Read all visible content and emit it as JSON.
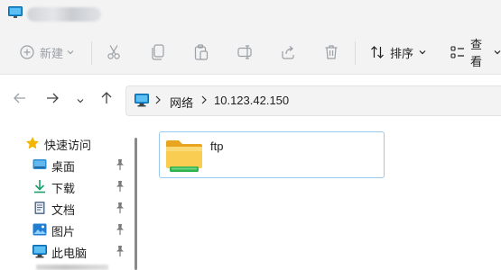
{
  "window": {
    "title_icon": "pc-icon"
  },
  "commandbar": {
    "new_label": "新建",
    "sort_label": "排序",
    "view_label": "查看",
    "icons": {
      "new": "plus-circle-icon",
      "cut": "scissors-icon",
      "copy": "copy-icon",
      "paste": "paste-icon",
      "rename": "rename-icon",
      "share": "share-icon",
      "delete": "trash-icon",
      "sort": "sort-icon",
      "view": "view-icon"
    }
  },
  "address": {
    "crumbs": [
      "网络",
      "10.123.42.150"
    ]
  },
  "sidebar": {
    "items": [
      {
        "label": "快速访问",
        "icon": "star-icon",
        "pinned": false
      },
      {
        "label": "桌面",
        "icon": "desktop-icon",
        "pinned": true
      },
      {
        "label": "下载",
        "icon": "download-icon",
        "pinned": true
      },
      {
        "label": "文档",
        "icon": "document-icon",
        "pinned": true
      },
      {
        "label": "图片",
        "icon": "picture-icon",
        "pinned": true
      },
      {
        "label": "此电脑",
        "icon": "pc-icon",
        "pinned": true
      }
    ]
  },
  "content": {
    "items": [
      {
        "name": "ftp",
        "icon": "shared-folder-icon",
        "selected": true
      }
    ]
  },
  "colors": {
    "accent": "#0067c0",
    "folder": "#f5c346",
    "selection_border": "#99c9ef"
  }
}
